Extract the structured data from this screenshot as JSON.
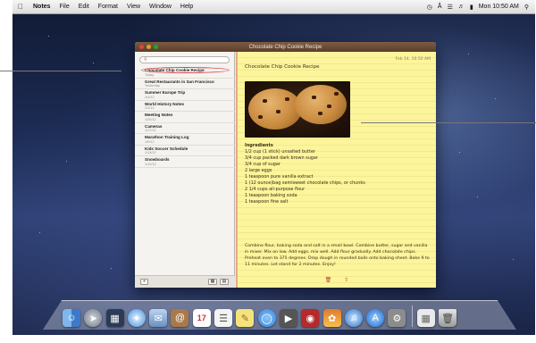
{
  "menubar": {
    "apple_icon": "apple-icon",
    "app_name": "Notes",
    "menus": [
      "File",
      "Edit",
      "Format",
      "View",
      "Window",
      "Help"
    ],
    "clock": "Mon 10:50 AM",
    "status_icons": [
      "time-machine-icon",
      "bluetooth-icon",
      "wifi-icon",
      "volume-icon",
      "battery-icon",
      "search-icon"
    ]
  },
  "window": {
    "title": "Chocolate Chip Cookie Recipe"
  },
  "sidebar": {
    "search_placeholder": "",
    "notes": [
      {
        "title": "Chocolate Chip Cookie Recipe",
        "date": "Today"
      },
      {
        "title": "Great Restaurants in San Francisco",
        "date": "Yesterday"
      },
      {
        "title": "Summer Europe Trip",
        "date": "2/4/12"
      },
      {
        "title": "World History Notes",
        "date": "2/1/12"
      },
      {
        "title": "Meeting Notes",
        "date": "1/20/12"
      },
      {
        "title": "Cameras",
        "date": "1/17/12"
      },
      {
        "title": "Marathon Training Log",
        "date": "1/9/12"
      },
      {
        "title": "Kids Soccer Schedule",
        "date": "1/13/12"
      },
      {
        "title": "Snowboards",
        "date": "1/10/12"
      }
    ],
    "add_label": "+"
  },
  "note": {
    "date": "Feb 14, 10:50 AM",
    "heading": "Chocolate Chip Cookie Recipe",
    "ingredients_header": "Ingredients",
    "ingredients": [
      "1/2 cup (1 stick) unsalted butter",
      "3/4 cup packed dark brown sugar",
      "3/4 cup of sugar",
      "2 large eggs",
      "1 teaspoon pure vanilla extract",
      "1 (12 ounce)bag semisweet chocolate chips, or chunks",
      "2 1/4 cups all-purpose flour",
      "1 teaspoon baking soda",
      "1 teaspoon fine salt"
    ],
    "directions": "Combine flour, baking soda and salt in a small bowl. Combine butter, sugar and vanilla in mixer. Mix on low. Add eggs, mix well. Add flour gradually. Add chocolate chips. Preheat oven to 375 degrees. Drop dough in rounded balls onto baking sheet. Bake 9 to 11 minutes. Let stand for 2 minutes. Enjoy!"
  },
  "dock": {
    "apps": [
      "finder-icon",
      "launchpad-icon",
      "mission-control-icon",
      "safari-icon",
      "mail-icon",
      "contacts-icon",
      "calendar-icon",
      "reminders-icon",
      "notes-icon",
      "messages-icon",
      "facetime-icon",
      "photo-booth-icon",
      "iphoto-icon",
      "itunes-icon",
      "app-store-icon",
      "system-preferences-icon",
      "preview-icon",
      "trash-icon"
    ],
    "calendar_day": "17"
  }
}
